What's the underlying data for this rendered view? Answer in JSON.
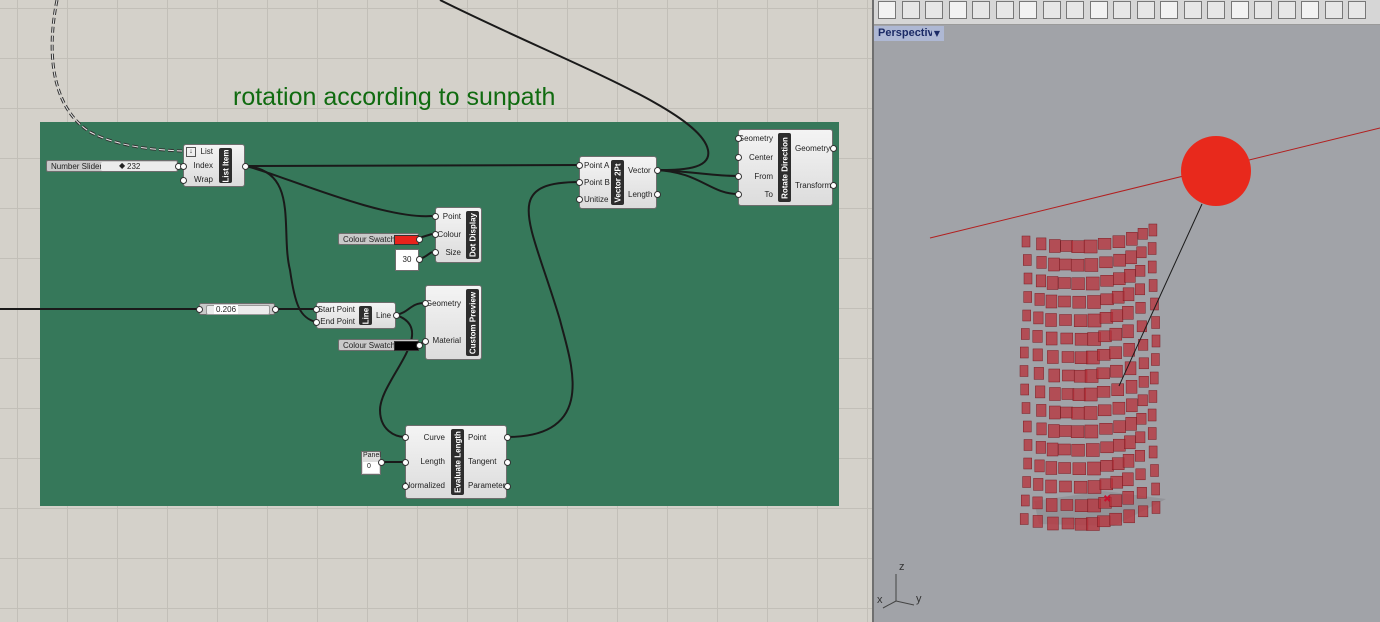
{
  "group": {
    "title": "rotation according to sunpath"
  },
  "number_slider": {
    "name": "Number Slider",
    "value": "232"
  },
  "list_item": {
    "title": "List Item",
    "inputs": [
      "List",
      "Index",
      "Wrap"
    ]
  },
  "vector2pt": {
    "title": "Vector 2Pt",
    "inputs": [
      "Point A",
      "Point B",
      "Unitize"
    ],
    "outputs": [
      "Vector",
      "Length"
    ]
  },
  "rotate_direction": {
    "title": "Rotate Direction",
    "inputs": [
      "Geometry",
      "Center",
      "From",
      "To"
    ],
    "outputs": [
      "Geometry",
      "Transform"
    ]
  },
  "dot_display": {
    "title": "Dot Display",
    "inputs": [
      "Point",
      "Colour",
      "Size"
    ]
  },
  "swatch_red": {
    "name": "Colour Swatch",
    "color": "#e8231c"
  },
  "size_panel": {
    "value": "30"
  },
  "slider2": {
    "value": "0.206"
  },
  "line": {
    "title": "Line",
    "inputs": [
      "Start Point",
      "End Point"
    ],
    "outputs": [
      "Line"
    ]
  },
  "custom_preview": {
    "title": "Custom Preview",
    "inputs": [
      "Geometry",
      "Material"
    ]
  },
  "swatch_black": {
    "name": "Colour Swatch",
    "color": "#000000"
  },
  "evaluate_length": {
    "title": "Evaluate Length",
    "inputs": [
      "Curve",
      "Length",
      "Normalized"
    ],
    "outputs": [
      "Point",
      "Tangent",
      "Parameter"
    ]
  },
  "panel": {
    "name": "Panel",
    "value": "0"
  },
  "viewport": {
    "label": "Perspective",
    "dropdown_icon": "triangle-down-icon",
    "axes": {
      "z": "z",
      "x": "x",
      "y": "y"
    },
    "sun_color": "#e8291c",
    "panel_color": "#b8303a"
  },
  "toolbar_icons": [
    "viewport-layout-icon",
    "new-viewport-icon",
    "grid-icon",
    "four-view-icon",
    "three-view-icon",
    "two-view-icon",
    "table-grid-icon",
    "zoom-icon",
    "zoom-extents-icon",
    "grid-settings-icon",
    "dot-icon",
    "material-icon",
    "render-icon",
    "page-icon",
    "layout-icon",
    "capture-icon",
    "bake-icon",
    "open-icon",
    "preview-icon",
    "print-icon",
    "info-icon"
  ]
}
